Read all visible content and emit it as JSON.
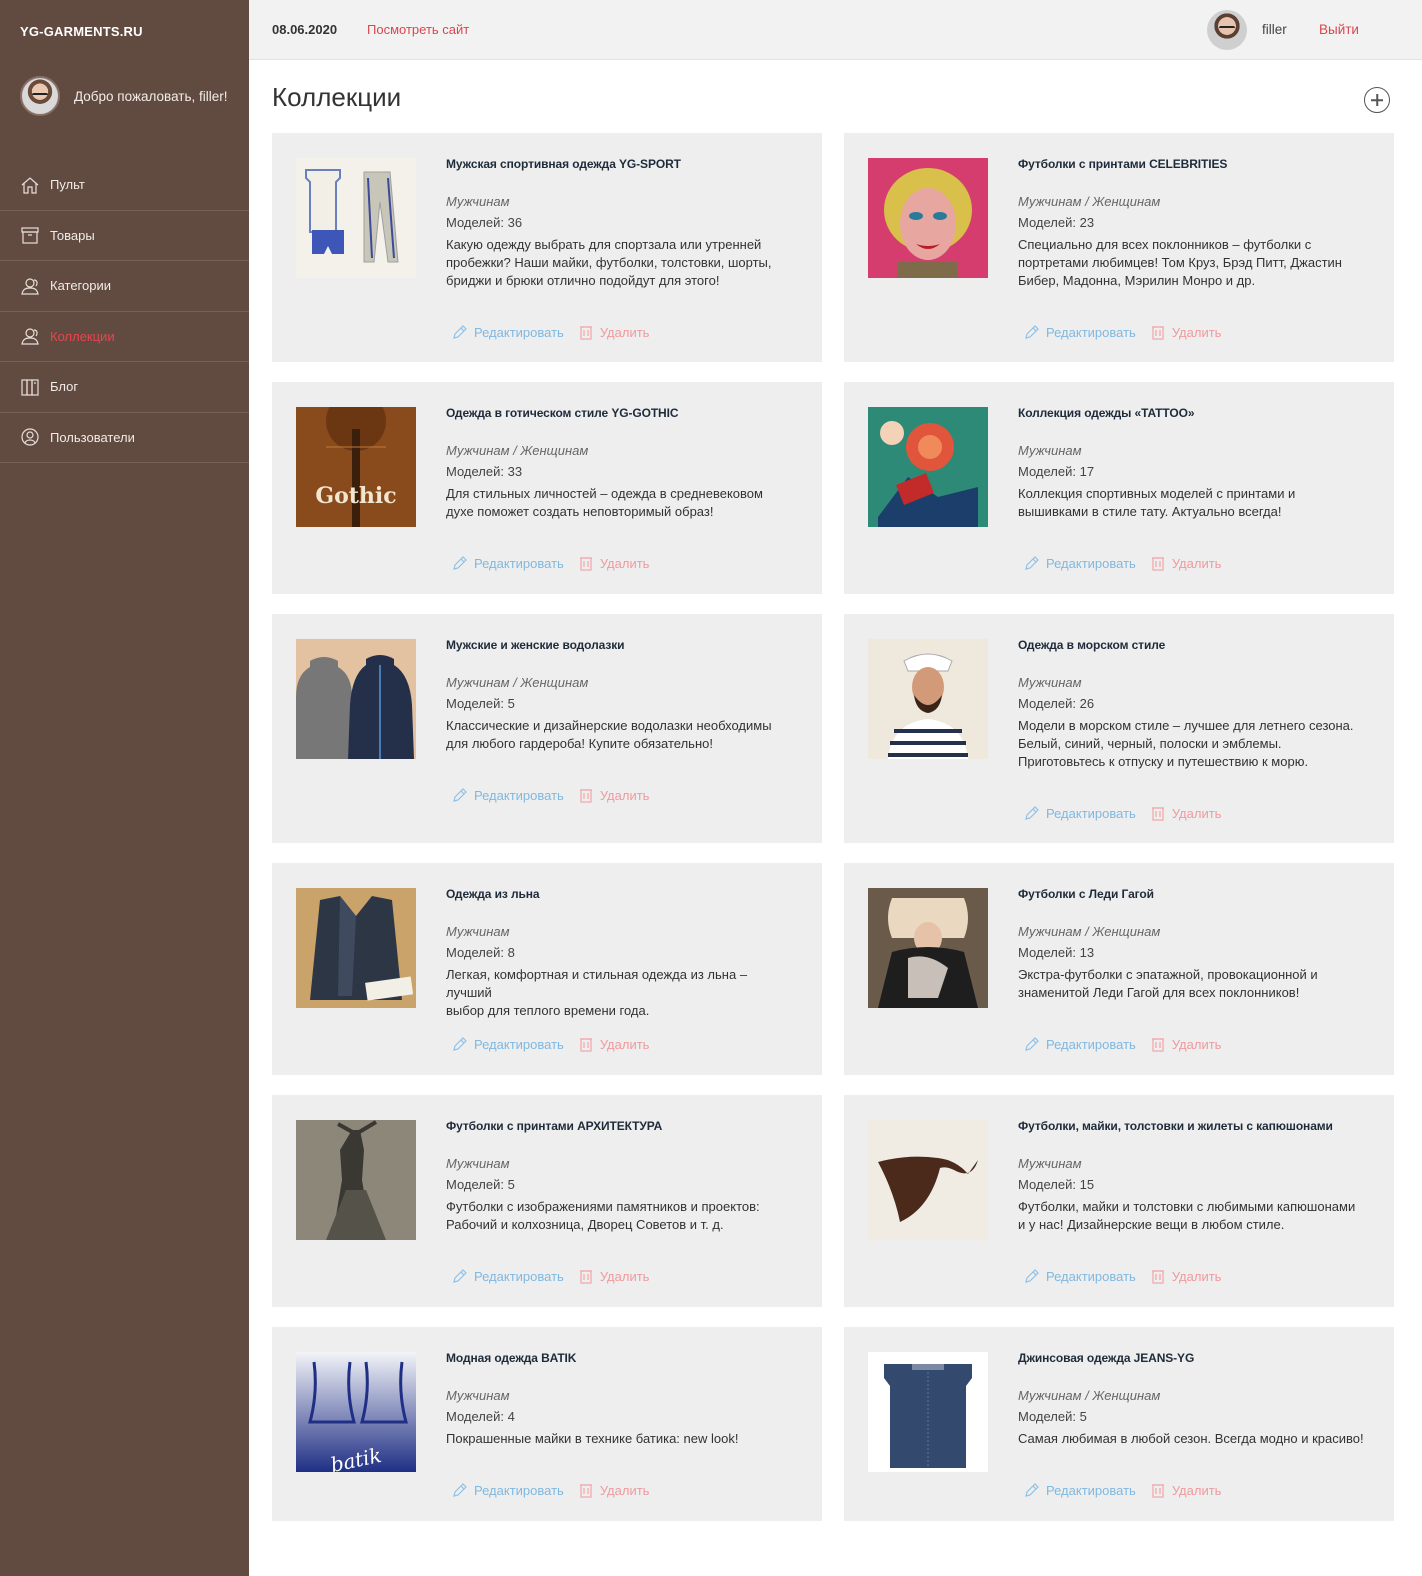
{
  "sidebar": {
    "logo": "YG-GARMENTS.RU",
    "welcome": "Добро пожаловать, filler!",
    "items": [
      {
        "label": "Пульт",
        "icon": "home-icon"
      },
      {
        "label": "Товары",
        "icon": "box-icon"
      },
      {
        "label": "Категории",
        "icon": "users-icon"
      },
      {
        "label": "Коллекции",
        "icon": "users-icon",
        "active": true
      },
      {
        "label": "Блог",
        "icon": "book-icon"
      },
      {
        "label": "Пользователи",
        "icon": "user-circle-icon"
      }
    ]
  },
  "topbar": {
    "date": "08.06.2020",
    "view_site": "Посмотреть сайт",
    "username": "filler",
    "logout": "Выйти"
  },
  "page": {
    "title": "Коллекции"
  },
  "actions": {
    "edit": "Редактировать",
    "delete": "Удалить"
  },
  "colors": {
    "sidebar": "#614b41",
    "accent": "#d9464e",
    "edit": "#7fb8e0",
    "delete": "#f09a9e",
    "card": "#eeeeee"
  },
  "collections": [
    {
      "title": "Мужская спортивная одежда YG-SPORT",
      "audience": "Мужчинам",
      "models": "Моделей: 36",
      "desc": [
        "Какую одежду выбрать для спортзала или утренней",
        "пробежки? Наши майки, футболки, толстовки, шорты,",
        "бриджи и брюки отлично подойдут для этого!"
      ]
    },
    {
      "title": "Футболки с принтами CELEBRITIES",
      "audience": "Мужчинам / Женщинам",
      "models": "Моделей: 23",
      "desc": [
        "Специально для всех поклонников – футболки с",
        "портретами любимцев! Том Круз, Брэд Питт, Джастин",
        "Бибер, Мадонна, Мэрилин Монро и др."
      ]
    },
    {
      "title": "Одежда в готическом стиле YG-GOTHIC",
      "audience": "Мужчинам / Женщинам",
      "models": "Моделей: 33",
      "desc": [
        "Для стильных личностей – одежда в средневековом",
        "духе поможет создать неповторимый образ!"
      ],
      "thumb_text": "Gothic"
    },
    {
      "title": "Коллекция одежды «TATTOO»",
      "audience": "Мужчинам",
      "models": "Моделей: 17",
      "desc": [
        "Коллекция спортивных моделей с принтами и",
        "вышивками в стиле тату. Актуально всегда!"
      ]
    },
    {
      "title": "Мужские и женские водолазки",
      "audience": "Мужчинам / Женщинам",
      "models": "Моделей: 5",
      "desc": [
        "Классические и дизайнерские водолазки необходимы",
        "для любого гардероба! Купите обязательно!"
      ]
    },
    {
      "title": "Одежда в морском стиле",
      "audience": "Мужчинам",
      "models": "Моделей: 26",
      "desc": [
        "Модели в морском стиле – лучшее для летнего сезона.",
        "Белый, синий, черный, полоски и эмблемы.",
        "Приготовьтесь к отпуску и путешествию к морю."
      ]
    },
    {
      "title": "Одежда из льна",
      "audience": "Мужчинам",
      "models": "Моделей: 8",
      "desc": [
        "Легкая, комфортная и стильная одежда из льна – лучший",
        "выбор для теплого времени года."
      ]
    },
    {
      "title": "Футболки с Леди Гагой",
      "audience": "Мужчинам / Женщинам",
      "models": "Моделей: 13",
      "desc": [
        "Экстра-футболки с эпатажной, провокационной и",
        "знаменитой Леди Гагой для всех поклонников!"
      ]
    },
    {
      "title": "Футболки с принтами АРХИТЕКТУРА",
      "audience": "Мужчинам",
      "models": "Моделей: 5",
      "desc": [
        "Футболки с изображениями памятников и проектов:",
        "Рабочий и колхозница, Дворец Советов и т. д."
      ]
    },
    {
      "title": "Футболки, майки, толстовки и жилеты с капюшонами",
      "audience": "Мужчинам",
      "models": "Моделей: 15",
      "desc": [
        "Футболки, майки и толстовки с любимыми капюшонами",
        "и у нас! Дизайнерские вещи в любом стиле."
      ]
    },
    {
      "title": "Модная одежда BATIK",
      "audience": "Мужчинам",
      "models": "Моделей: 4",
      "desc": [
        "Покрашенные майки в технике батика: new look!"
      ],
      "thumb_text": "batik"
    },
    {
      "title": "Джинсовая одежда JEANS-YG",
      "audience": "Мужчинам / Женщинам",
      "models": "Моделей: 5",
      "desc": [
        "Самая любимая в любой сезон. Всегда модно и красиво!"
      ]
    }
  ]
}
